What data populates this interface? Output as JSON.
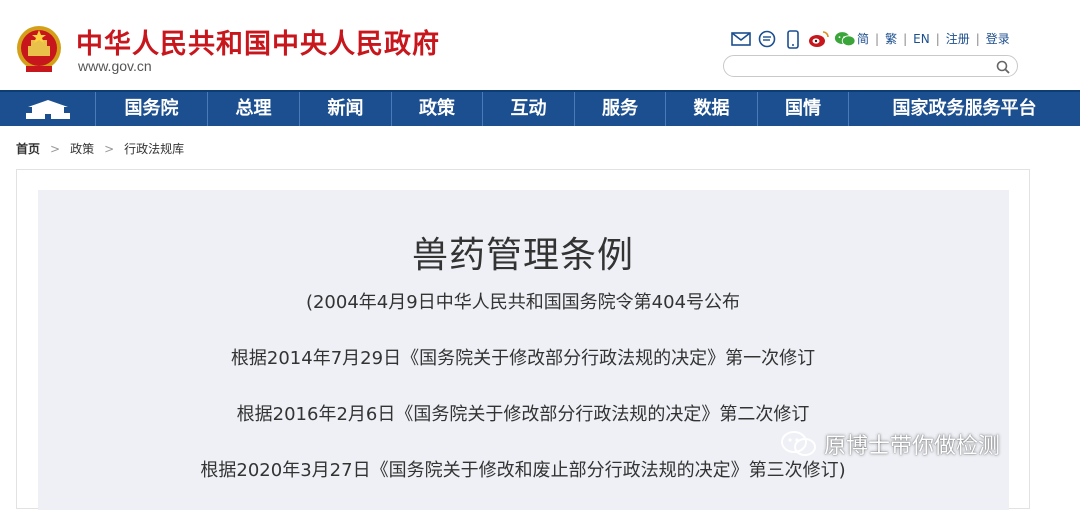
{
  "header": {
    "site_title": "中华人民共和国中央人民政府",
    "site_url": "www.gov.cn",
    "icons": [
      "mail-icon",
      "chat-bubble-icon",
      "mobile-icon",
      "weibo-icon",
      "wechat-icon"
    ],
    "links": [
      "简",
      "繁",
      "EN",
      "注册",
      "登录"
    ],
    "search_placeholder": ""
  },
  "nav": {
    "items": [
      "国务院",
      "总理",
      "新闻",
      "政策",
      "互动",
      "服务",
      "数据",
      "国情",
      "国家政务服务平台"
    ]
  },
  "breadcrumb": [
    "首页",
    "政策",
    "行政法规库"
  ],
  "document": {
    "title": "兽药管理条例",
    "lines": [
      "(2004年4月9日中华人民共和国国务院令第404号公布",
      "根据2014年7月29日《国务院关于修改部分行政法规的决定》第一次修订",
      "根据2016年2月6日《国务院关于修改部分行政法规的决定》第二次修订",
      "根据2020年3月27日《国务院关于修改和废止部分行政法规的决定》第三次修订)"
    ]
  },
  "watermark": {
    "text": "原博士带你做检测"
  },
  "colors": {
    "brand_red": "#c8161d",
    "nav_blue": "#1c4f8f",
    "link_blue": "#1c4f8f",
    "doc_bg": "#eef0f5"
  }
}
